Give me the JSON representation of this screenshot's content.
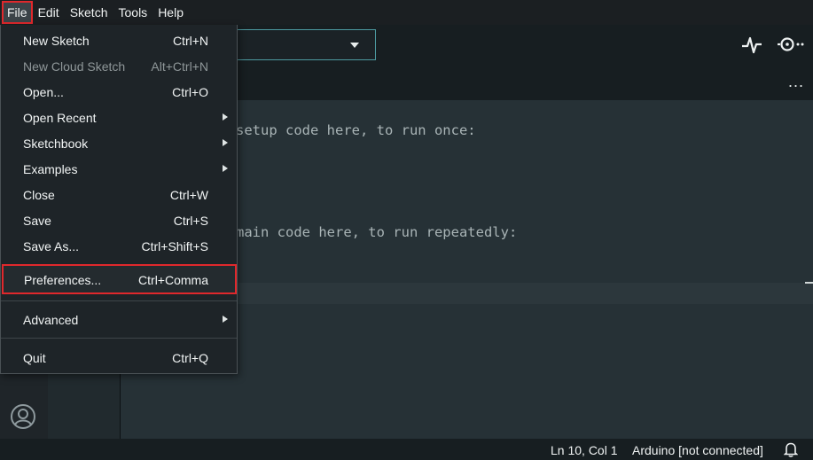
{
  "menubar": {
    "items": [
      "File",
      "Edit",
      "Sketch",
      "Tools",
      "Help"
    ]
  },
  "file_menu": {
    "items": [
      {
        "label": "New Sketch",
        "shortcut": "Ctrl+N"
      },
      {
        "label": "New Cloud Sketch",
        "shortcut": "Alt+Ctrl+N",
        "disabled": true
      },
      {
        "label": "Open...",
        "shortcut": "Ctrl+O"
      },
      {
        "label": "Open Recent",
        "submenu": true
      },
      {
        "label": "Sketchbook",
        "submenu": true
      },
      {
        "label": "Examples",
        "submenu": true
      },
      {
        "label": "Close",
        "shortcut": "Ctrl+W"
      },
      {
        "label": "Save",
        "shortcut": "Ctrl+S"
      },
      {
        "label": "Save As...",
        "shortcut": "Ctrl+Shift+S"
      },
      {
        "label": "Preferences...",
        "shortcut": "Ctrl+Comma"
      },
      {
        "label": "Advanced",
        "submenu": true
      },
      {
        "label": "Quit",
        "shortcut": "Ctrl+Q"
      }
    ]
  },
  "editor": {
    "line1": "setup code here, to run once:",
    "line2": "main code here, to run repeatedly:"
  },
  "toolbar": {
    "more_label": "..."
  },
  "status": {
    "position": "Ln 10, Col 1",
    "board": "Arduino [not connected]"
  },
  "colors": {
    "highlight_outline": "#e0282c",
    "accent": "#4d9aa0"
  }
}
